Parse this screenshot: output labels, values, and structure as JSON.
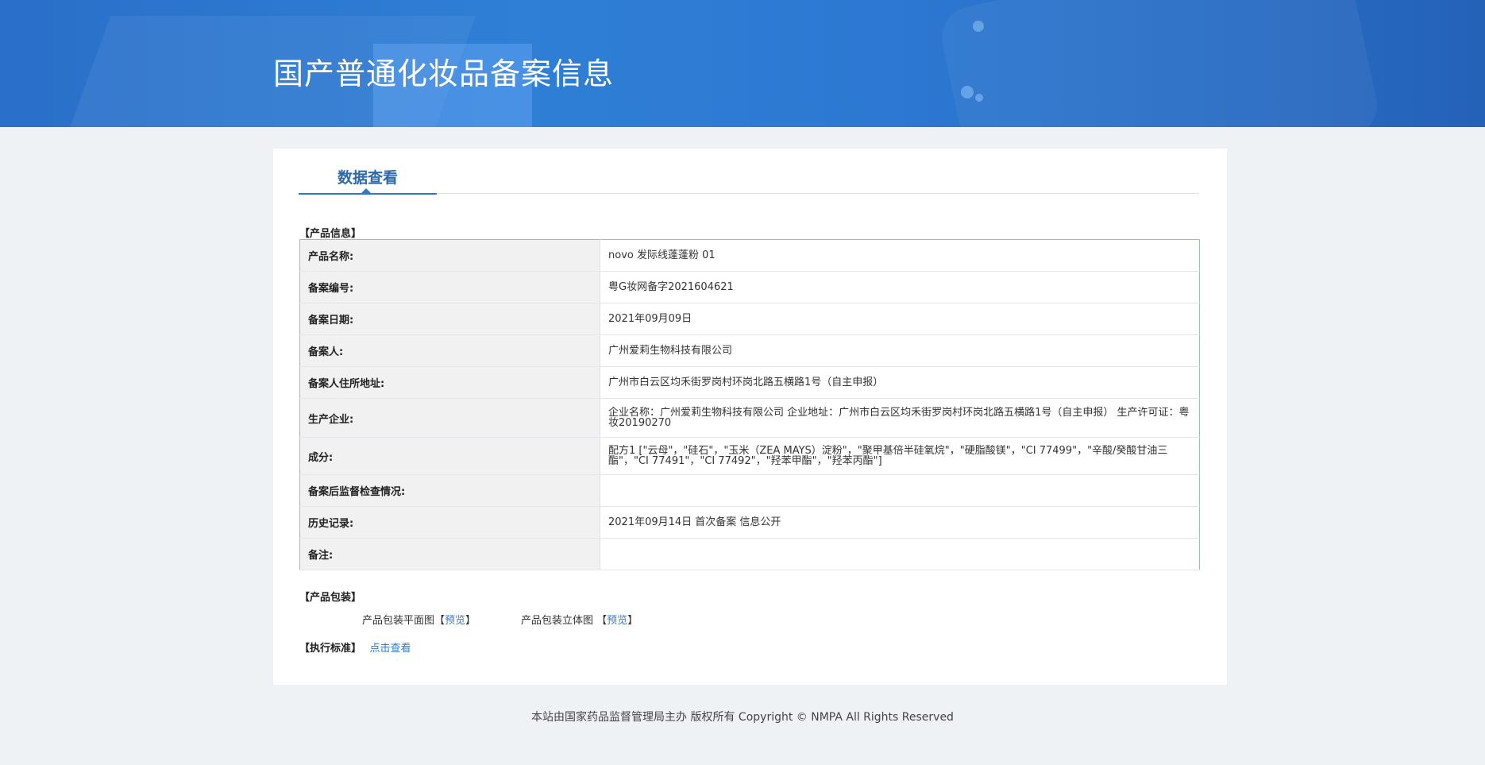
{
  "header": {
    "title": "国产普通化妆品备案信息"
  },
  "tab": {
    "label": "数据查看"
  },
  "product_info": {
    "section_title": "【产品信息】",
    "rows": [
      {
        "label": "产品名称:",
        "value": "novo 发际线蓬蓬粉 01"
      },
      {
        "label": "备案编号:",
        "value": "粤G妆网备字2021604621"
      },
      {
        "label": "备案日期:",
        "value": "2021年09月09日"
      },
      {
        "label": "备案人:",
        "value": "广州爱莉生物科技有限公司"
      },
      {
        "label": "备案人住所地址:",
        "value": "广州市白云区均禾街罗岗村环岗北路五横路1号（自主申报）"
      },
      {
        "label": "生产企业:",
        "value": "企业名称：广州爱莉生物科技有限公司 企业地址：广州市白云区均禾街罗岗村环岗北路五横路1号（自主申报） 生产许可证：粤妆20190270"
      },
      {
        "label": "成分:",
        "value": "配方1 [\"云母\"，\"硅石\"，\"玉米（ZEA MAYS）淀粉\"，\"聚甲基倍半硅氧烷\"，\"硬脂酸镁\"，\"CI 77499\"，\"辛酸/癸酸甘油三酯\"，\"CI 77491\"，\"CI 77492\"，\"羟苯甲酯\"，\"羟苯丙酯\"]"
      },
      {
        "label": "备案后监督检查情况:",
        "value": ""
      },
      {
        "label": "历史记录:",
        "value": "2021年09月14日 首次备案 信息公开"
      },
      {
        "label": "备注:",
        "value": ""
      }
    ]
  },
  "packaging": {
    "section_title": "【产品包装】",
    "flat_label": "产品包装平面图",
    "stereo_label": "产品包装立体图",
    "bracket_open": "【",
    "bracket_close": "】",
    "preview_link": "预览"
  },
  "standard": {
    "section_title": "【执行标准】",
    "link": "点击查看"
  },
  "footer": {
    "text": "本站由国家药品监督管理局主办 版权所有 Copyright © NMPA All Rights Reserved"
  }
}
